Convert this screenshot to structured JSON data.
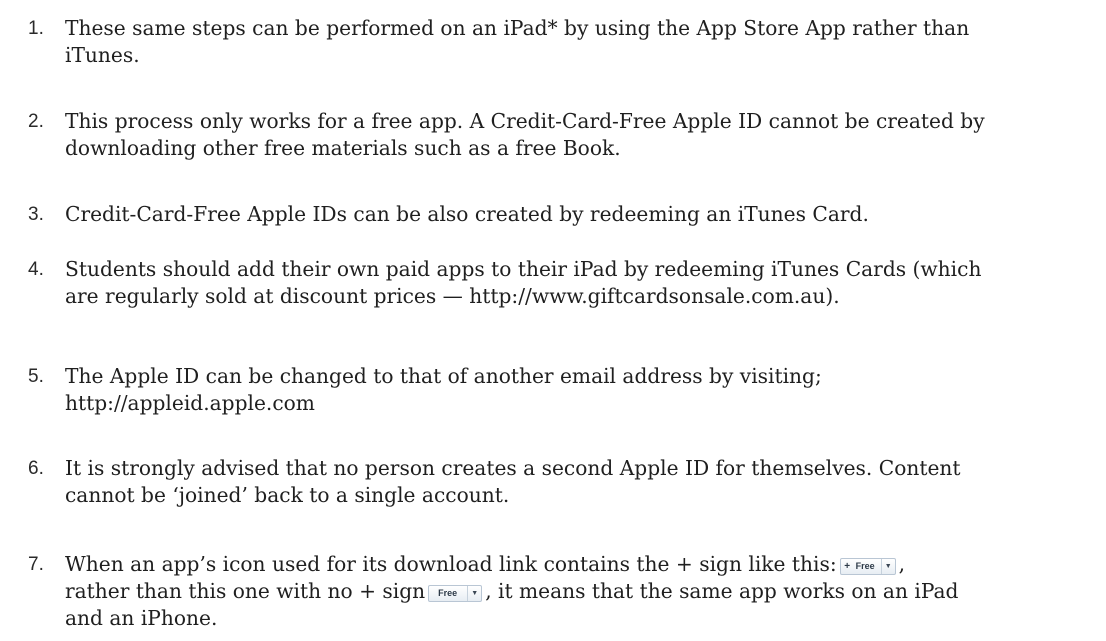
{
  "items": [
    {
      "number": "1.",
      "lines": [
        "These same steps can be performed on an iPad* by using the App Store App rather than",
        "iTunes."
      ]
    },
    {
      "number": "2.",
      "lines": [
        "This process only works for a free app. A Credit-Card-Free Apple ID cannot be created by",
        "downloading other free materials such as a free Book."
      ]
    },
    {
      "number": "3.",
      "lines": [
        "Credit-Card-Free Apple IDs can be also created by redeeming an iTunes Card."
      ]
    },
    {
      "number": "4.",
      "lines": [
        "Students should add their own paid apps to their iPad by redeeming iTunes Cards (which",
        "are regularly sold at discount prices — http://www.giftcardsonsale.com.au)."
      ]
    },
    {
      "number": "5.",
      "lines": [
        "The Apple ID can be changed to that of another email address by visiting;",
        "http://appleid.apple.com"
      ]
    },
    {
      "number": "6.",
      "lines": [
        "It is strongly advised that no person creates a second Apple ID for themselves. Content",
        "cannot be ‘joined’ back to a single account."
      ]
    },
    {
      "number": "7.",
      "line1_before": "When an app’s icon used for its download link contains the + sign like this:",
      "line1_after": ",",
      "line2_before": "rather than this one with no + sign",
      "line2_after": ", it means that the same app works on an iPad",
      "line3": "and an iPhone."
    }
  ],
  "buttons": {
    "plus_symbol": "+",
    "free_label": "Free",
    "caret_glyph": "▼"
  }
}
